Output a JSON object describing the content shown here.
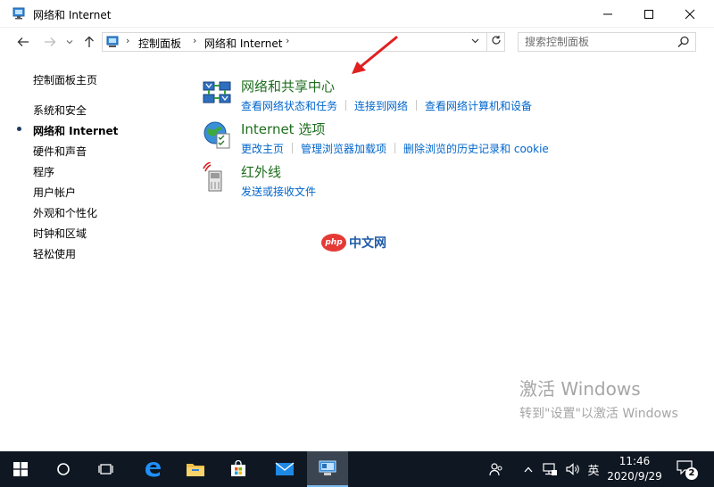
{
  "window": {
    "title": "网络和 Internet",
    "minimize_label": "—",
    "maximize_label": "☐",
    "close_label": "✕"
  },
  "addressbar": {
    "crumbs": [
      "控制面板",
      "网络和 Internet"
    ],
    "search_placeholder": "搜索控制面板"
  },
  "leftnav": {
    "home": "控制面板主页",
    "items": [
      {
        "label": "系统和安全",
        "active": false
      },
      {
        "label": "网络和 Internet",
        "active": true
      },
      {
        "label": "硬件和声音",
        "active": false
      },
      {
        "label": "程序",
        "active": false
      },
      {
        "label": "用户帐户",
        "active": false
      },
      {
        "label": "外观和个性化",
        "active": false
      },
      {
        "label": "时钟和区域",
        "active": false
      },
      {
        "label": "轻松使用",
        "active": false
      }
    ]
  },
  "categories": [
    {
      "title": "网络和共享中心",
      "icon": "network-sharing-center-icon",
      "links": [
        "查看网络状态和任务",
        "连接到网络",
        "查看网络计算机和设备"
      ]
    },
    {
      "title": "Internet 选项",
      "icon": "internet-options-globe-icon",
      "links": [
        "更改主页",
        "管理浏览器加载项",
        "删除浏览的历史记录和 cookie"
      ]
    },
    {
      "title": "红外线",
      "icon": "infrared-icon",
      "links": [
        "发送或接收文件"
      ]
    }
  ],
  "watermark": {
    "badge": "php",
    "text": "中文网"
  },
  "activation": {
    "line1": "激活 Windows",
    "line2": "转到\"设置\"以激活 Windows"
  },
  "taskbar": {
    "ime": "英",
    "time": "11:46",
    "date": "2020/9/29",
    "notification_count": "2"
  },
  "colors": {
    "link": "#0066cc",
    "category_title": "#1e6e1e",
    "taskbar": "#0f1722",
    "arrow": "#e02020"
  }
}
